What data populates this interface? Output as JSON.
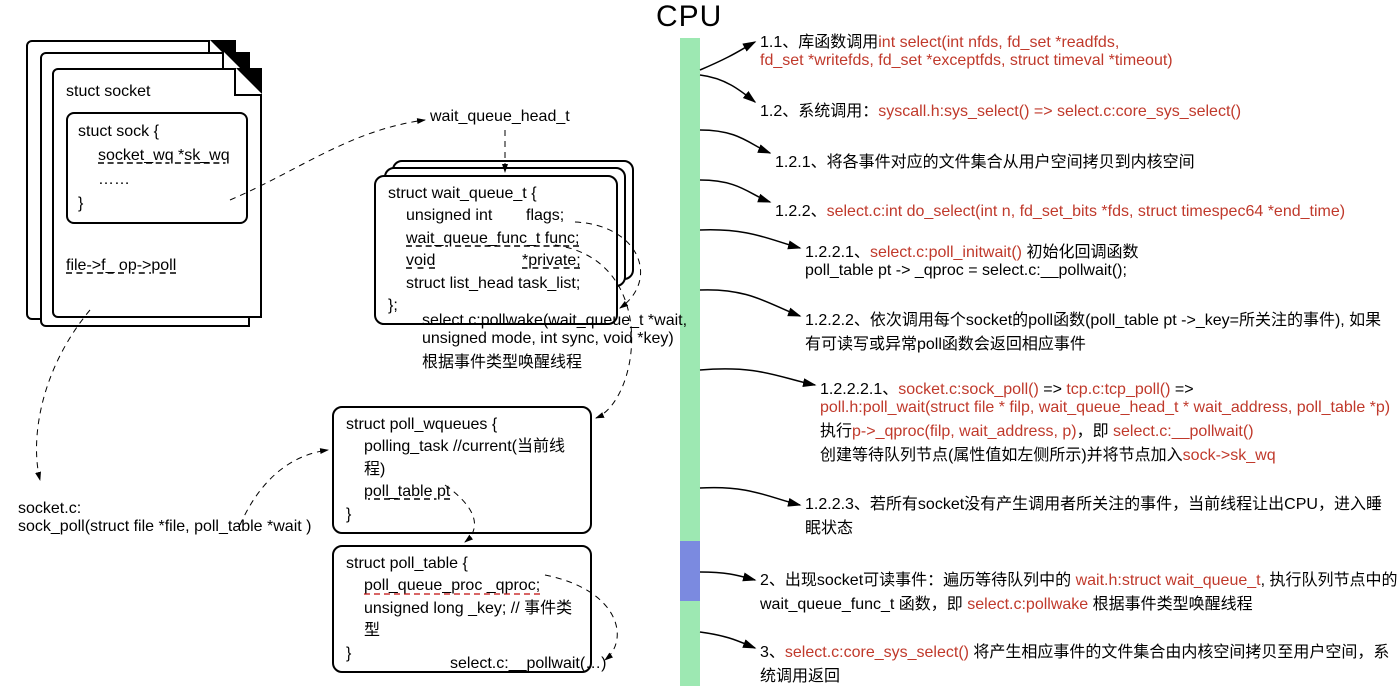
{
  "cpu_title": "CPU",
  "left": {
    "socket_title": "stuct socket",
    "sock_struct_open": "stuct sock {",
    "sock_field": "socket_wq *sk_wq",
    "sock_ellipsis": "……",
    "sock_close": "}",
    "file_poll": "file->f_ op->poll",
    "wq_head_label": "wait_queue_head_t",
    "wq_struct": "struct wait_queue_t {",
    "wq_l1_left": "unsigned int",
    "wq_l1_right": "flags;",
    "wq_l2_left": "wait_queue_func_t   func;",
    "wq_l3_left": "void",
    "wq_l3_right": "*private;",
    "wq_l4": "struct list_head   task_list;",
    "wq_close": "};",
    "pollwake_text": "select.c:pollwake(wait_queue_t *wait,\nunsigned mode, int sync, void *key)\n根据事件类型唤醒线程",
    "poll_wqueues_open": "struct poll_wqueues {",
    "poll_wqueues_l1": "polling_task //current(当前线程)",
    "poll_wqueues_l2": "poll_table pt",
    "poll_wqueues_close": "}",
    "sock_poll_label": "socket.c:\nsock_poll(struct file *file, poll_table *wait )",
    "poll_table_open": "struct poll_table {",
    "poll_table_l1": "poll_queue_proc _qproc;",
    "poll_table_l2": "unsigned long _key; // 事件类型",
    "poll_table_close": "}",
    "pollwait_label": "select.c:__pollwait(…)"
  },
  "steps": {
    "s11a": "1.1、库函数调用",
    "s11b": "int select(int nfds, fd_set *readfds,",
    "s11c": "fd_set *writefds, fd_set *exceptfds, struct timeval *timeout)",
    "s12a": "1.2、系统调用：",
    "s12b": "syscall.h:sys_select() => select.c:core_sys_select()",
    "s121": "1.2.1、将各事件对应的文件集合从用户空间拷贝到内核空间",
    "s122a": "1.2.2、",
    "s122b": "select.c:int do_select(int n, fd_set_bits *fds, struct timespec64 *end_time)",
    "s1221a": "1.2.2.1、",
    "s1221b": "select.c:poll_initwait()",
    "s1221c": " 初始化回调函数",
    "s1221d": "poll_table pt -> _qproc = select.c:__pollwait();",
    "s1222": "1.2.2.2、依次调用每个socket的poll函数(poll_table pt ->_key=所关注的事件), 如果有可读写或异常poll函数会返回相应事件",
    "s12221a": "1.2.2.2.1、",
    "s12221b": "socket.c:sock_poll()",
    "s12221c": " => ",
    "s12221d": "tcp.c:tcp_poll()",
    "s12221e": " =>",
    "s12221f": "poll.h:poll_wait(struct file * filp, wait_queue_head_t * wait_address, poll_table *p)",
    "s12221g": "执行",
    "s12221h": "p->_qproc(filp, wait_address, p)",
    "s12221i": "，即 ",
    "s12221j": "select.c:__pollwait()",
    "s12221k": "创建等待队列节点(属性值如左侧所示)并将节点加入",
    "s12221l": "sock->sk_wq",
    "s1223": "1.2.2.3、若所有socket没有产生调用者所关注的事件，当前线程让出CPU，进入睡眠状态",
    "s2a": "2、出现socket可读事件：遍历等待队列中的 ",
    "s2b": "wait.h:struct wait_queue_t",
    "s2c": ", 执行队列节点中的 wait_queue_func_t 函数，即 ",
    "s2d": "select.c:pollwake",
    "s2e": " 根据事件类型唤醒线程",
    "s3a": "3、",
    "s3b": "select.c:core_sys_select()",
    "s3c": " 将产生相应事件的文件集合由内核空间拷贝至用户空间，系统调用返回"
  }
}
